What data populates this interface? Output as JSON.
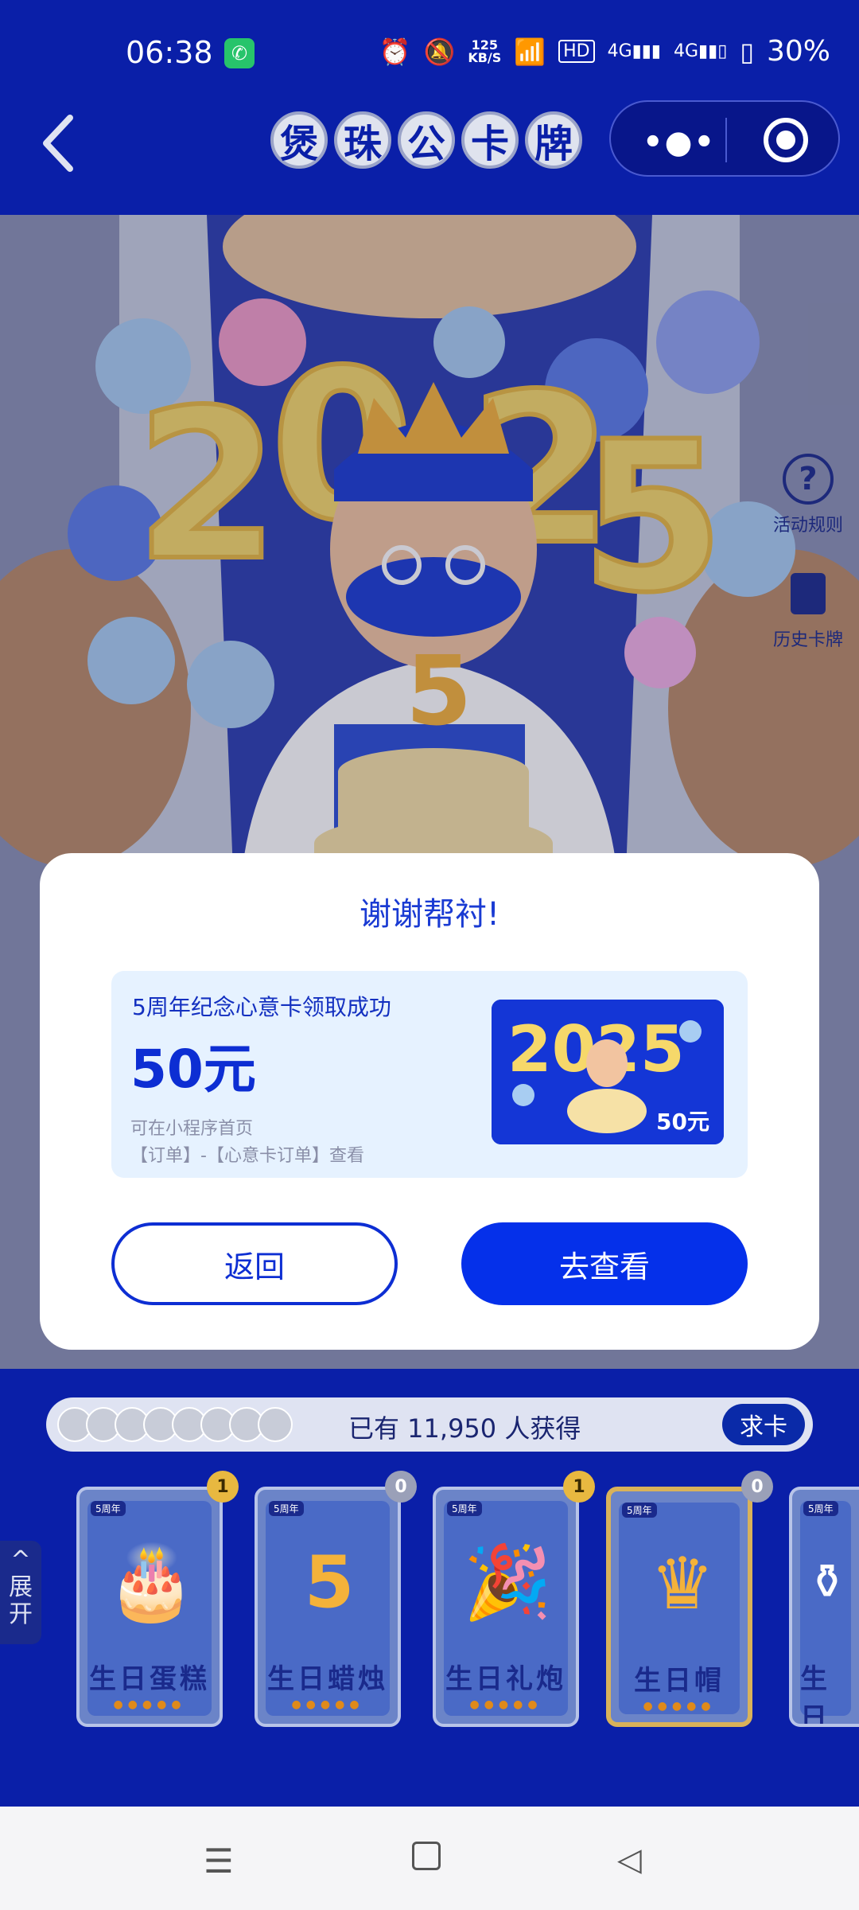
{
  "status_bar": {
    "time": "06:38",
    "network_speed": "125\nKB/S",
    "battery": "30%"
  },
  "nav": {
    "title_chars": [
      "煲",
      "珠",
      "公",
      "卡",
      "牌"
    ],
    "more_icon": "more-dots-icon",
    "close_icon": "target-icon"
  },
  "hero": {
    "year_art": "2025",
    "candle_number": "5",
    "side_actions": [
      {
        "label": "活动规则",
        "icon": "question-circle-icon"
      },
      {
        "label": "历史卡牌",
        "icon": "cards-icon"
      }
    ]
  },
  "modal": {
    "title": "谢谢帮衬!",
    "headline": "5周年纪念心意卡领取成功",
    "amount": "50元",
    "note_line1": "可在小程序首页",
    "note_line2": "【订单】-【心意卡订单】查看",
    "card_value": "50元",
    "back_label": "返回",
    "view_label": "去查看"
  },
  "holders": {
    "text": "已有 11,950 人获得",
    "ask_label": "求卡"
  },
  "expand": {
    "label": "展开"
  },
  "cards": [
    {
      "name": "生日蛋糕",
      "count": "1",
      "tag": "5周年",
      "icon": "cake-icon",
      "selected": false
    },
    {
      "name": "生日蜡烛",
      "count": "0",
      "tag": "5周年",
      "icon": "candle-icon",
      "selected": false
    },
    {
      "name": "生日礼炮",
      "count": "1",
      "tag": "5周年",
      "icon": "party-popper-icon",
      "selected": false
    },
    {
      "name": "生日帽",
      "count": "0",
      "tag": "5周年",
      "icon": "crown-icon",
      "selected": true
    },
    {
      "name": "生日",
      "count": "",
      "tag": "5周年",
      "icon": "bottle-icon",
      "selected": false
    }
  ],
  "colors": {
    "brand_blue": "#0a1fa8",
    "accent_blue": "#0530ea",
    "gold": "#d9b25a"
  }
}
